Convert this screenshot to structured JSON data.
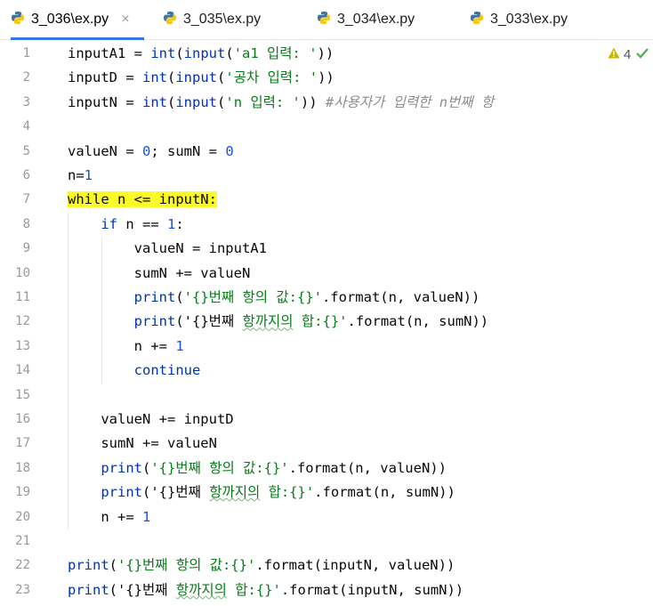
{
  "tabs": [
    {
      "label": "3_036\\ex.py",
      "active": true
    },
    {
      "label": "3_035\\ex.py",
      "active": false
    },
    {
      "label": "3_034\\ex.py",
      "active": false
    },
    {
      "label": "3_033\\ex.py",
      "active": false
    }
  ],
  "tab_close_glyph": "×",
  "inspection": {
    "warning_count": "4"
  },
  "line_numbers": [
    "1",
    "2",
    "3",
    "4",
    "5",
    "6",
    "7",
    "8",
    "9",
    "10",
    "11",
    "12",
    "13",
    "14",
    "15",
    "16",
    "17",
    "18",
    "19",
    "20",
    "21",
    "22",
    "23"
  ],
  "code_lines": [
    [
      {
        "t": "inputA1 = "
      },
      {
        "t": "int",
        "c": "kw"
      },
      {
        "t": "("
      },
      {
        "t": "input",
        "c": "kw"
      },
      {
        "t": "("
      },
      {
        "t": "'a1 입력: '",
        "c": "str"
      },
      {
        "t": "))"
      }
    ],
    [
      {
        "t": "inputD = "
      },
      {
        "t": "int",
        "c": "kw"
      },
      {
        "t": "("
      },
      {
        "t": "input",
        "c": "kw"
      },
      {
        "t": "("
      },
      {
        "t": "'공차 입력: '",
        "c": "str"
      },
      {
        "t": "))"
      }
    ],
    [
      {
        "t": "inputN = "
      },
      {
        "t": "int",
        "c": "kw"
      },
      {
        "t": "("
      },
      {
        "t": "input",
        "c": "kw"
      },
      {
        "t": "("
      },
      {
        "t": "'n 입력: '",
        "c": "str"
      },
      {
        "t": ")) "
      },
      {
        "t": "#사용자가 입력한 n번째 항",
        "c": "cmt"
      }
    ],
    [],
    [
      {
        "t": "valueN = "
      },
      {
        "t": "0",
        "c": "num"
      },
      {
        "t": "; sumN = "
      },
      {
        "t": "0",
        "c": "num"
      }
    ],
    [
      {
        "t": "n="
      },
      {
        "t": "1",
        "c": "num"
      }
    ],
    [
      {
        "t": "while n <= inputN:",
        "c": "hl"
      }
    ],
    [
      {
        "t": "    "
      },
      {
        "t": "if",
        "c": "kw"
      },
      {
        "t": " n == "
      },
      {
        "t": "1",
        "c": "num"
      },
      {
        "t": ":"
      }
    ],
    [
      {
        "t": "        valueN = inputA1"
      }
    ],
    [
      {
        "t": "        sumN += valueN"
      }
    ],
    [
      {
        "t": "        "
      },
      {
        "t": "print",
        "c": "kw"
      },
      {
        "t": "("
      },
      {
        "t": "'{}번째 항의 값:{}'",
        "c": "str"
      },
      {
        "t": ".format(n, valueN))"
      }
    ],
    [
      {
        "t": "        "
      },
      {
        "t": "print",
        "c": "kw"
      },
      {
        "t": "("
      },
      {
        "t": "'{}번째 "
      },
      {
        "t": "항까지의",
        "c": "str typo"
      },
      {
        "t": " 합:{}'",
        "c": "str"
      },
      {
        "t": ".format(n, sumN))"
      }
    ],
    [
      {
        "t": "        n += "
      },
      {
        "t": "1",
        "c": "num"
      }
    ],
    [
      {
        "t": "        "
      },
      {
        "t": "continue",
        "c": "kw"
      }
    ],
    [],
    [
      {
        "t": "    valueN += inputD"
      }
    ],
    [
      {
        "t": "    sumN += valueN"
      }
    ],
    [
      {
        "t": "    "
      },
      {
        "t": "print",
        "c": "kw"
      },
      {
        "t": "("
      },
      {
        "t": "'{}번째 항의 값:{}'",
        "c": "str"
      },
      {
        "t": ".format(n, valueN))"
      }
    ],
    [
      {
        "t": "    "
      },
      {
        "t": "print",
        "c": "kw"
      },
      {
        "t": "("
      },
      {
        "t": "'{}번째 "
      },
      {
        "t": "항까지의",
        "c": "str typo"
      },
      {
        "t": " 합:{}'",
        "c": "str"
      },
      {
        "t": ".format(n, sumN))"
      }
    ],
    [
      {
        "t": "    n += "
      },
      {
        "t": "1",
        "c": "num"
      }
    ],
    [],
    [
      {
        "t": "print",
        "c": "kw"
      },
      {
        "t": "("
      },
      {
        "t": "'{}번째 항의 값:{}'",
        "c": "str"
      },
      {
        "t": ".format(inputN, valueN))"
      }
    ],
    [
      {
        "t": "print",
        "c": "kw"
      },
      {
        "t": "("
      },
      {
        "t": "'{}번째 "
      },
      {
        "t": "항까지의",
        "c": "str typo"
      },
      {
        "t": " 합:{}'",
        "c": "str"
      },
      {
        "t": ".format(inputN, sumN))"
      }
    ]
  ],
  "colors": {
    "keyword": "#0033b3",
    "number": "#1750eb",
    "string": "#067d17",
    "comment": "#8c8c8c",
    "highlight": "#fbfb2a",
    "tab_underline": "#3574f0",
    "warning": "#b3a300",
    "check": "#4caf50"
  }
}
